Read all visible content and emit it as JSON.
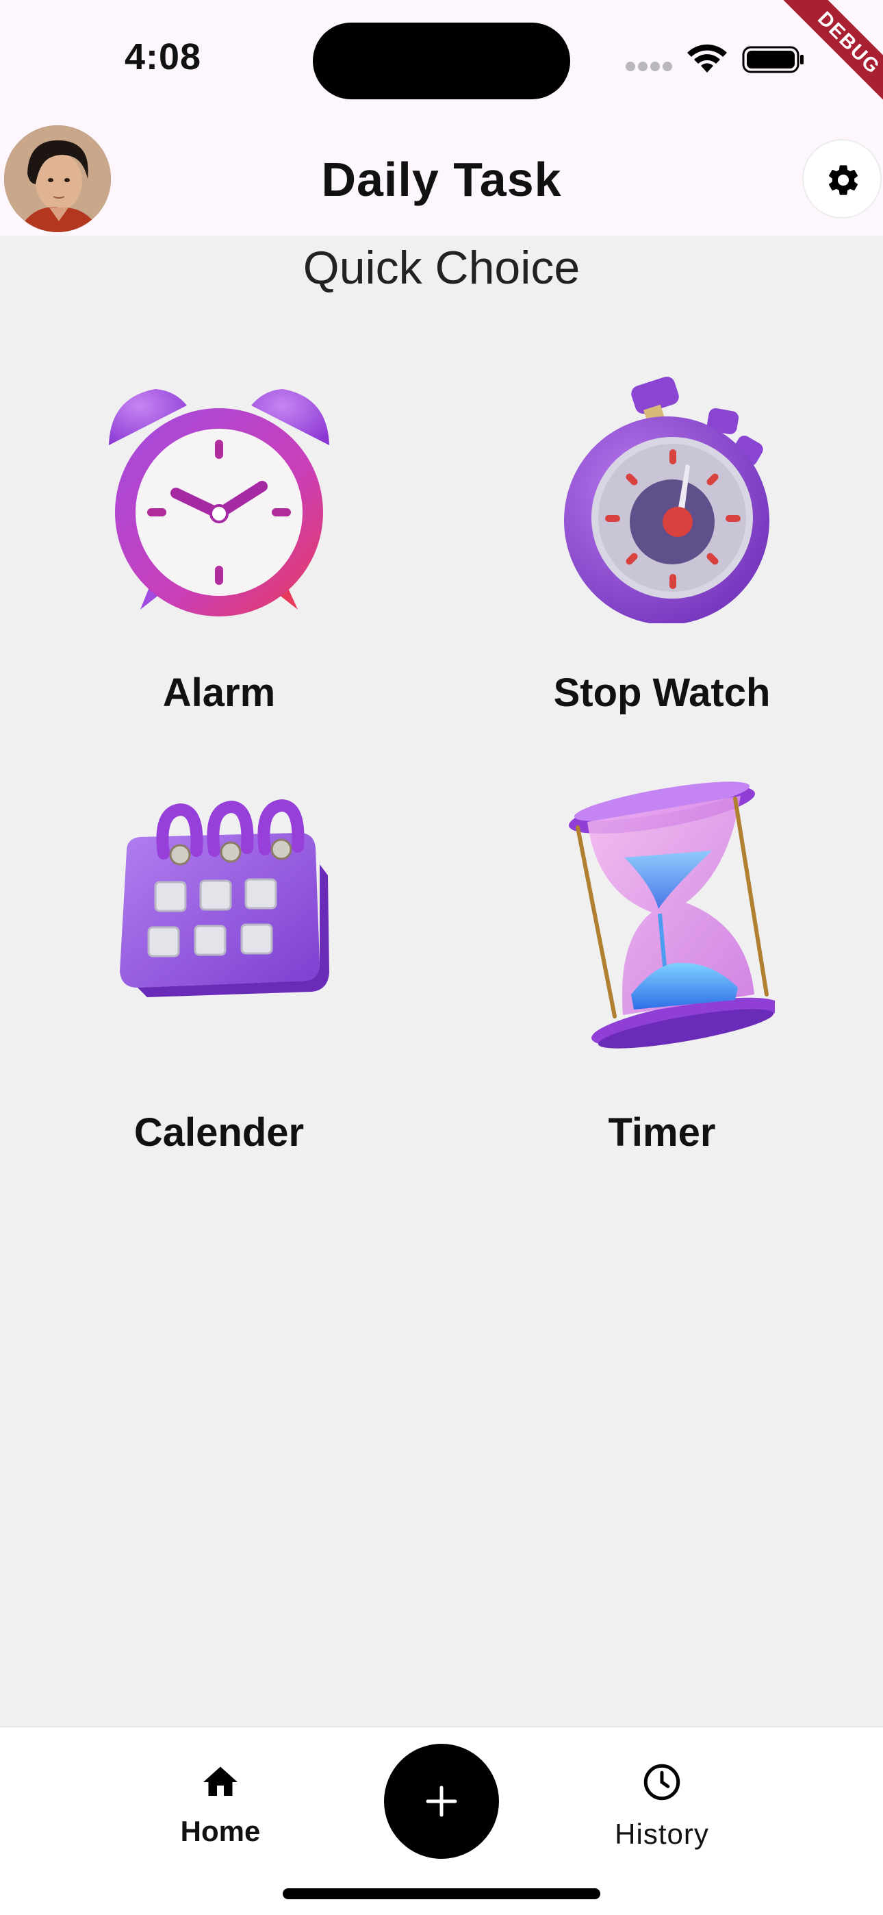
{
  "status_bar": {
    "time": "4:08",
    "icons": [
      "signal-dots-icon",
      "wifi-icon",
      "battery-icon"
    ]
  },
  "debug_banner": "DEBUG",
  "header": {
    "title": "Daily Task",
    "avatar": "profile-avatar",
    "settings_icon": "gear-icon"
  },
  "main": {
    "section_title": "Quick Choice",
    "tiles": [
      {
        "label": "Alarm",
        "icon": "alarm-clock-icon"
      },
      {
        "label": "Stop Watch",
        "icon": "stopwatch-icon"
      },
      {
        "label": "Calender",
        "icon": "calendar-icon"
      },
      {
        "label": "Timer",
        "icon": "hourglass-icon"
      }
    ]
  },
  "bottom_nav": {
    "items": [
      {
        "label": "Home",
        "icon": "home-icon",
        "selected": true
      },
      {
        "label": "History",
        "icon": "clock-icon",
        "selected": false
      }
    ],
    "fab_icon": "plus-icon"
  },
  "colors": {
    "header_bg": "#fdf6fd",
    "page_bg": "#f0f0f0",
    "accent_purple": "#8e3fd6",
    "debug_red": "#a82032"
  }
}
